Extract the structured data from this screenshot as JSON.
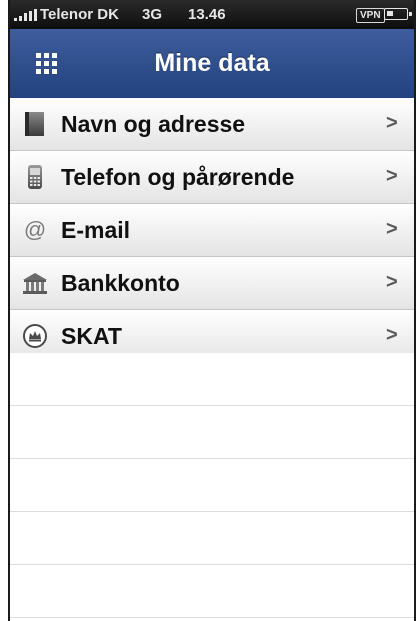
{
  "status_bar": {
    "carrier": "Telenor DK",
    "network": "3G",
    "time": "13.46",
    "vpn": "VPN",
    "signal_icon": "signal-bars-icon",
    "battery_icon": "battery-icon"
  },
  "nav": {
    "title": "Mine data",
    "menu_icon": "grid-icon"
  },
  "menu": {
    "items": [
      {
        "label": "Navn og adresse",
        "icon": "id-card-icon"
      },
      {
        "label": "Telefon og pårørende",
        "icon": "phone-icon"
      },
      {
        "label": "E-mail",
        "icon": "at-icon"
      },
      {
        "label": "Bankkonto",
        "icon": "bank-icon"
      },
      {
        "label": "SKAT",
        "icon": "crown-seal-icon"
      }
    ],
    "chevron": ">"
  },
  "colors": {
    "navbar_top": "#3f5d9c",
    "navbar_bottom": "#21417f",
    "statusbar": "#1a1a1a"
  }
}
